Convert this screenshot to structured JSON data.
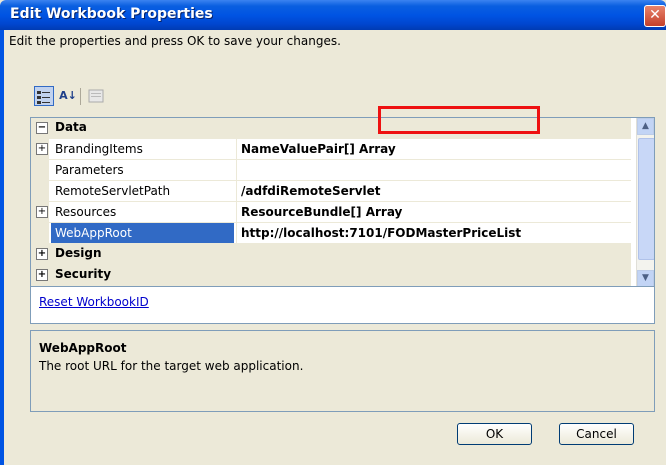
{
  "window": {
    "title": "Edit Workbook Properties",
    "close_glyph": "✕"
  },
  "description": "Edit the properties and press OK to save your changes.",
  "toolbar": {
    "categorized_icon": "categorized-icon",
    "alphabetical_label": "A↓",
    "property_pages_icon": "property-pages-icon"
  },
  "grid": {
    "categories": [
      {
        "label": "Data",
        "expander": "⊟"
      },
      {
        "label": "Design",
        "expander": "⊞"
      },
      {
        "label": "Security",
        "expander": "⊞"
      }
    ],
    "properties": [
      {
        "name": "BrandingItems",
        "value": "NameValuePair[] Array",
        "expandable": true,
        "expander": "+"
      },
      {
        "name": "Parameters",
        "value": "",
        "expandable": false,
        "expander": ""
      },
      {
        "name": "RemoteServletPath",
        "value": "/adfdiRemoteServlet",
        "expandable": false,
        "expander": ""
      },
      {
        "name": "Resources",
        "value": "ResourceBundle[] Array",
        "expandable": true,
        "expander": "+"
      },
      {
        "name": "WebAppRoot",
        "value": "http://localhost:7101/FODMasterPriceList",
        "expandable": false,
        "expander": "",
        "selected": true
      }
    ],
    "scroll_up_glyph": "▲",
    "scroll_down_glyph": "▼"
  },
  "reset_link": "Reset WorkbookID",
  "help": {
    "title": "WebAppRoot",
    "description": "The root URL for the target web application."
  },
  "buttons": {
    "ok": "OK",
    "cancel": "Cancel"
  },
  "colors": {
    "titlebar": "#0054e3",
    "selection": "#316ac5",
    "highlight_box": "#e11111",
    "link": "#0000cc",
    "dialog_bg": "#ECE9D8"
  }
}
